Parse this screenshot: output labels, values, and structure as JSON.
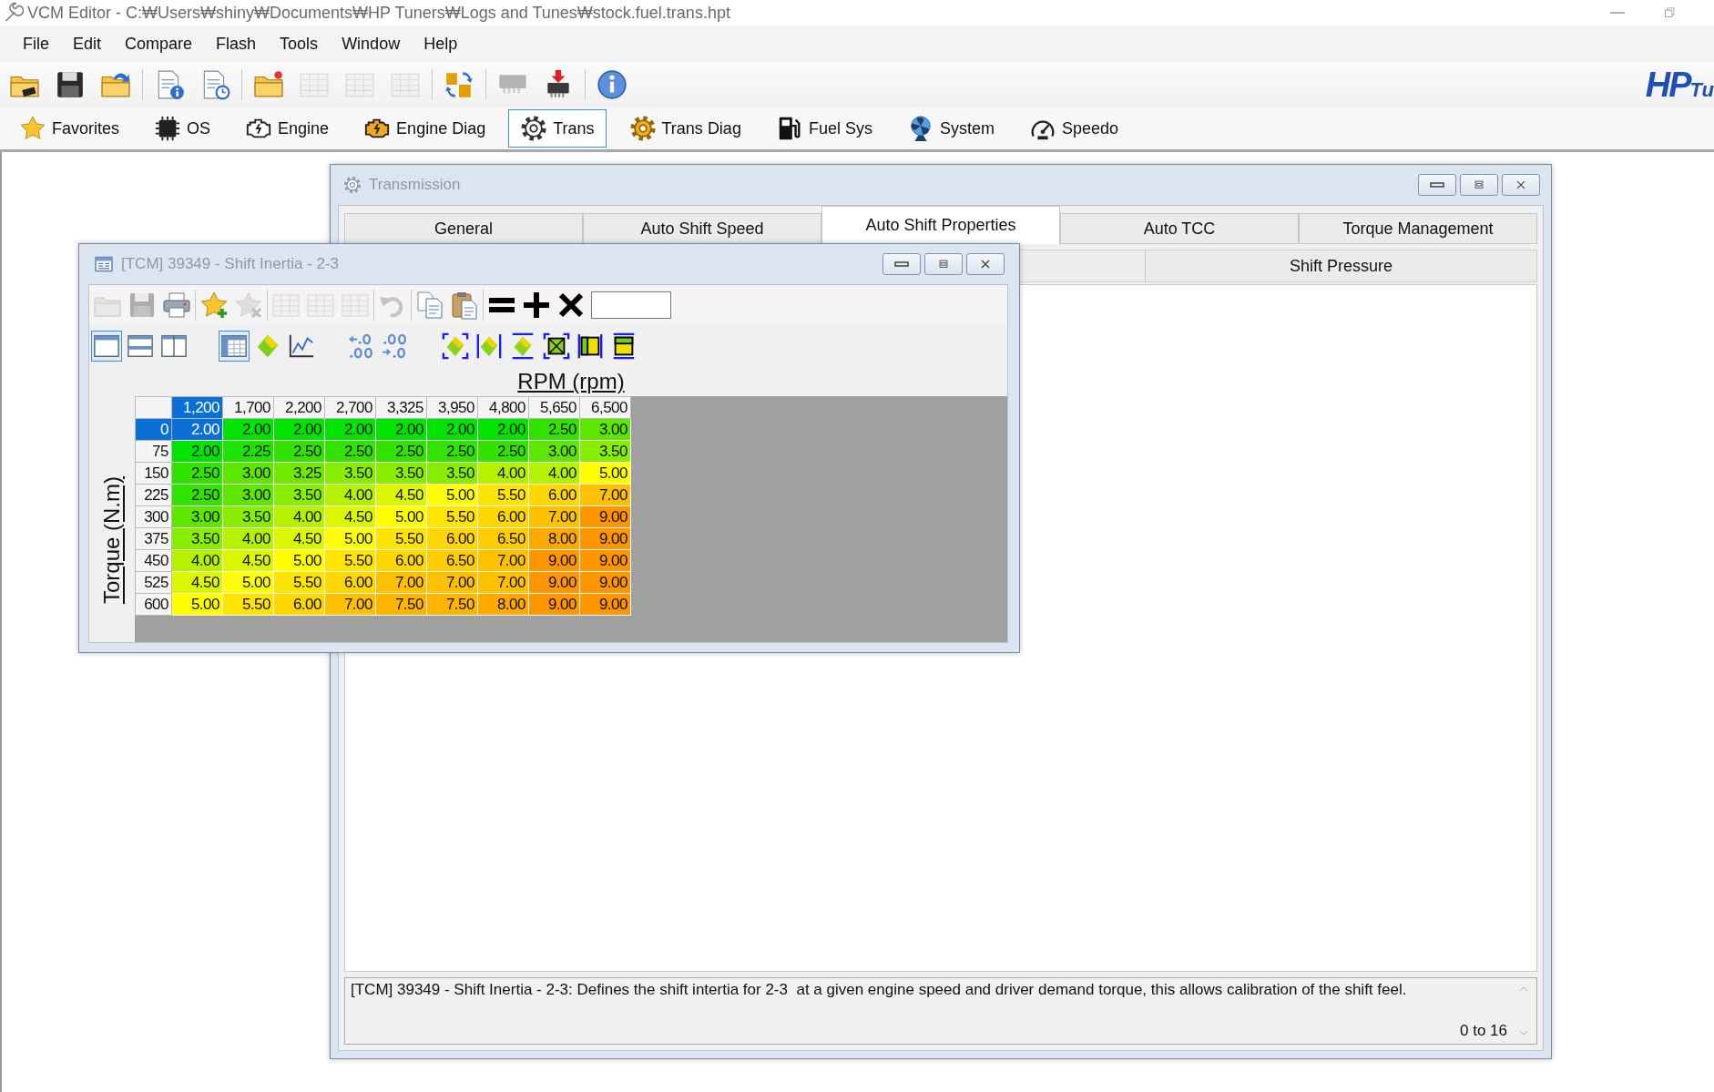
{
  "window": {
    "title": "VCM Editor - C:₩Users₩shiny₩Documents₩HP Tuners₩Logs and Tunes₩stock.fuel.trans.hpt"
  },
  "menu": [
    "File",
    "Edit",
    "Compare",
    "Flash",
    "Tools",
    "Window",
    "Help"
  ],
  "toolbar": [
    {
      "disabled": false
    },
    {
      "disabled": false
    },
    {
      "disabled": false
    },
    {
      "disabled": false
    },
    {
      "disabled": false
    },
    {
      "disabled": false
    },
    {
      "disabled": true
    },
    {
      "disabled": true
    },
    {
      "disabled": true
    },
    {
      "disabled": false
    },
    {
      "disabled": true
    },
    {
      "disabled": false
    },
    {
      "disabled": false
    }
  ],
  "logo": {
    "main": "HP",
    "tail": "Tu"
  },
  "nav": [
    {
      "label": "Favorites",
      "selected": false
    },
    {
      "label": "OS",
      "selected": false
    },
    {
      "label": "Engine",
      "selected": false
    },
    {
      "label": "Engine Diag",
      "selected": false
    },
    {
      "label": "Trans",
      "selected": true
    },
    {
      "label": "Trans Diag",
      "selected": false
    },
    {
      "label": "Fuel Sys",
      "selected": false
    },
    {
      "label": "System",
      "selected": false
    },
    {
      "label": "Speedo",
      "selected": false
    }
  ],
  "transmission": {
    "title": "Transmission",
    "tabs": [
      {
        "label": "General",
        "selected": false
      },
      {
        "label": "Auto Shift Speed",
        "selected": false
      },
      {
        "label": "Auto Shift Properties",
        "selected": true
      },
      {
        "label": "Auto TCC",
        "selected": false
      },
      {
        "label": "Torque Management",
        "selected": false
      }
    ],
    "subtabs": [
      {
        "label": "Shift Pressure",
        "selected": false
      }
    ],
    "description": "[TCM] 39349 - Shift Inertia - 2-3: Defines the shift intertia for 2-3  at a given engine speed and driver demand torque, this allows calibration of the shift feel.",
    "range": "0 to 16"
  },
  "table_window": {
    "title": "[TCM] 39349 - Shift Inertia - 2-3",
    "toolbar": [
      {
        "disabled": true
      },
      {
        "disabled": true
      },
      {
        "disabled": false
      },
      {
        "disabled": false
      },
      {
        "disabled": true
      },
      {
        "disabled": true
      },
      {
        "disabled": true
      },
      {
        "disabled": true
      },
      {
        "disabled": true
      },
      {
        "disabled": false
      },
      {
        "disabled": false
      },
      {
        "disabled": false
      },
      {
        "disabled": false
      },
      {
        "disabled": false
      }
    ],
    "view_toolbar": [
      {
        "selected": true
      },
      {
        "selected": false
      },
      {
        "selected": false
      },
      {
        "selected": true
      },
      {
        "selected": false
      },
      {
        "selected": false
      },
      {
        "selected": false
      },
      {
        "selected": false
      },
      {
        "selected": false
      },
      {
        "selected": false
      },
      {
        "selected": false
      },
      {
        "selected": false
      },
      {
        "selected": false
      },
      {
        "selected": false
      }
    ],
    "x_axis": "RPM (rpm)",
    "y_axis": "Torque (N.m)",
    "columns": [
      {
        "label": "1,200",
        "selected": true
      },
      {
        "label": "1,700",
        "selected": false
      },
      {
        "label": "2,200",
        "selected": false
      },
      {
        "label": "2,700",
        "selected": false
      },
      {
        "label": "3,325",
        "selected": false
      },
      {
        "label": "3,950",
        "selected": false
      },
      {
        "label": "4,800",
        "selected": false
      },
      {
        "label": "5,650",
        "selected": false
      },
      {
        "label": "6,500",
        "selected": false
      }
    ],
    "rows": [
      {
        "label": "0",
        "selected": true,
        "cells": [
          {
            "value": "2.00",
            "selected": true
          },
          {
            "value": "2.00",
            "color": "#00e400",
            "selected": false
          },
          {
            "value": "2.00",
            "color": "#00e400",
            "selected": false
          },
          {
            "value": "2.00",
            "color": "#00e400",
            "selected": false
          },
          {
            "value": "2.00",
            "color": "#00e400",
            "selected": false
          },
          {
            "value": "2.00",
            "color": "#00e400",
            "selected": false
          },
          {
            "value": "2.00",
            "color": "#00e400",
            "selected": false
          },
          {
            "value": "2.50",
            "color": "#33e300",
            "selected": false
          },
          {
            "value": "3.00",
            "color": "#5ce600",
            "selected": false
          }
        ]
      },
      {
        "label": "75",
        "selected": false,
        "cells": [
          {
            "value": "2.00",
            "color": "#00e400",
            "selected": false
          },
          {
            "value": "2.25",
            "color": "#1ee400",
            "selected": false
          },
          {
            "value": "2.50",
            "color": "#33e300",
            "selected": false
          },
          {
            "value": "2.50",
            "color": "#33e300",
            "selected": false
          },
          {
            "value": "2.50",
            "color": "#33e300",
            "selected": false
          },
          {
            "value": "2.50",
            "color": "#33e300",
            "selected": false
          },
          {
            "value": "2.50",
            "color": "#33e300",
            "selected": false
          },
          {
            "value": "3.00",
            "color": "#5ce600",
            "selected": false
          },
          {
            "value": "3.50",
            "color": "#88ee00",
            "selected": false
          }
        ]
      },
      {
        "label": "150",
        "selected": false,
        "cells": [
          {
            "value": "2.50",
            "color": "#33e300",
            "selected": false
          },
          {
            "value": "3.00",
            "color": "#5ce600",
            "selected": false
          },
          {
            "value": "3.25",
            "color": "#70e800",
            "selected": false
          },
          {
            "value": "3.50",
            "color": "#88ee00",
            "selected": false
          },
          {
            "value": "3.50",
            "color": "#88ee00",
            "selected": false
          },
          {
            "value": "3.50",
            "color": "#88ee00",
            "selected": false
          },
          {
            "value": "4.00",
            "color": "#b4f200",
            "selected": false
          },
          {
            "value": "4.00",
            "color": "#b4f200",
            "selected": false
          },
          {
            "value": "5.00",
            "color": "#ffff00",
            "selected": false
          }
        ]
      },
      {
        "label": "225",
        "selected": false,
        "cells": [
          {
            "value": "2.50",
            "color": "#33e300",
            "selected": false
          },
          {
            "value": "3.00",
            "color": "#5ce600",
            "selected": false
          },
          {
            "value": "3.50",
            "color": "#88ee00",
            "selected": false
          },
          {
            "value": "4.00",
            "color": "#b4f200",
            "selected": false
          },
          {
            "value": "4.50",
            "color": "#dcf800",
            "selected": false
          },
          {
            "value": "5.00",
            "color": "#ffff00",
            "selected": false
          },
          {
            "value": "5.50",
            "color": "#ffe400",
            "selected": false
          },
          {
            "value": "6.00",
            "color": "#ffd700",
            "selected": false
          },
          {
            "value": "7.00",
            "color": "#ffc000",
            "selected": false
          }
        ]
      },
      {
        "label": "300",
        "selected": false,
        "cells": [
          {
            "value": "3.00",
            "color": "#5ce600",
            "selected": false
          },
          {
            "value": "3.50",
            "color": "#88ee00",
            "selected": false
          },
          {
            "value": "4.00",
            "color": "#b4f200",
            "selected": false
          },
          {
            "value": "4.50",
            "color": "#dcf800",
            "selected": false
          },
          {
            "value": "5.00",
            "color": "#ffff00",
            "selected": false
          },
          {
            "value": "5.50",
            "color": "#ffe400",
            "selected": false
          },
          {
            "value": "6.00",
            "color": "#ffd700",
            "selected": false
          },
          {
            "value": "7.00",
            "color": "#ffc000",
            "selected": false
          },
          {
            "value": "9.00",
            "color": "#ff9600",
            "selected": false
          }
        ]
      },
      {
        "label": "375",
        "selected": false,
        "cells": [
          {
            "value": "3.50",
            "color": "#88ee00",
            "selected": false
          },
          {
            "value": "4.00",
            "color": "#b4f200",
            "selected": false
          },
          {
            "value": "4.50",
            "color": "#dcf800",
            "selected": false
          },
          {
            "value": "5.00",
            "color": "#ffff00",
            "selected": false
          },
          {
            "value": "5.50",
            "color": "#ffe400",
            "selected": false
          },
          {
            "value": "6.00",
            "color": "#ffd700",
            "selected": false
          },
          {
            "value": "6.50",
            "color": "#ffcc00",
            "selected": false
          },
          {
            "value": "8.00",
            "color": "#ffa800",
            "selected": false
          },
          {
            "value": "9.00",
            "color": "#ff9600",
            "selected": false
          }
        ]
      },
      {
        "label": "450",
        "selected": false,
        "cells": [
          {
            "value": "4.00",
            "color": "#b4f200",
            "selected": false
          },
          {
            "value": "4.50",
            "color": "#dcf800",
            "selected": false
          },
          {
            "value": "5.00",
            "color": "#ffff00",
            "selected": false
          },
          {
            "value": "5.50",
            "color": "#ffe400",
            "selected": false
          },
          {
            "value": "6.00",
            "color": "#ffd700",
            "selected": false
          },
          {
            "value": "6.50",
            "color": "#ffcc00",
            "selected": false
          },
          {
            "value": "7.00",
            "color": "#ffc000",
            "selected": false
          },
          {
            "value": "9.00",
            "color": "#ff9600",
            "selected": false
          },
          {
            "value": "9.00",
            "color": "#ff9600",
            "selected": false
          }
        ]
      },
      {
        "label": "525",
        "selected": false,
        "cells": [
          {
            "value": "4.50",
            "color": "#dcf800",
            "selected": false
          },
          {
            "value": "5.00",
            "color": "#ffff00",
            "selected": false
          },
          {
            "value": "5.50",
            "color": "#ffe400",
            "selected": false
          },
          {
            "value": "6.00",
            "color": "#ffd700",
            "selected": false
          },
          {
            "value": "7.00",
            "color": "#ffc000",
            "selected": false
          },
          {
            "value": "7.00",
            "color": "#ffc000",
            "selected": false
          },
          {
            "value": "7.00",
            "color": "#ffc000",
            "selected": false
          },
          {
            "value": "9.00",
            "color": "#ff9600",
            "selected": false
          },
          {
            "value": "9.00",
            "color": "#ff9600",
            "selected": false
          }
        ]
      },
      {
        "label": "600",
        "selected": false,
        "cells": [
          {
            "value": "5.00",
            "color": "#ffff00",
            "selected": false
          },
          {
            "value": "5.50",
            "color": "#ffe400",
            "selected": false
          },
          {
            "value": "6.00",
            "color": "#ffd700",
            "selected": false
          },
          {
            "value": "7.00",
            "color": "#ffc000",
            "selected": false
          },
          {
            "value": "7.50",
            "color": "#ffb400",
            "selected": false
          },
          {
            "value": "7.50",
            "color": "#ffb400",
            "selected": false
          },
          {
            "value": "8.00",
            "color": "#ffa800",
            "selected": false
          },
          {
            "value": "9.00",
            "color": "#ff9600",
            "selected": false
          },
          {
            "value": "9.00",
            "color": "#ff9600",
            "selected": false
          }
        ]
      }
    ]
  }
}
